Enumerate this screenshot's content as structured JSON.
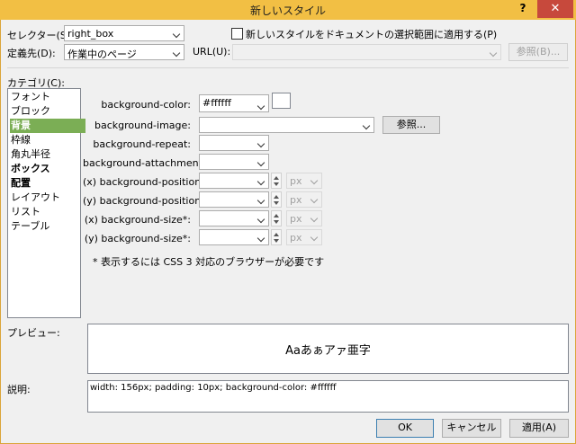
{
  "window": {
    "title": "新しいスタイル",
    "help": "?",
    "close": "✕"
  },
  "selector": {
    "label": "セレクター(S):",
    "value": "right_box"
  },
  "apply_selection": {
    "label": "新しいスタイルをドキュメントの選択範囲に適用する(P)"
  },
  "definition": {
    "label": "定義先(D):",
    "value": "作業中のページ"
  },
  "url": {
    "label": "URL(U):",
    "value": "",
    "browse": "参照(B)..."
  },
  "category": {
    "label": "カテゴリ(C):",
    "items": [
      "フォント",
      "ブロック",
      "背景",
      "枠線",
      "角丸半径",
      "ボックス",
      "配置",
      "レイアウト",
      "リスト",
      "テーブル"
    ]
  },
  "fields": {
    "bg_color": {
      "label": "background-color:",
      "value": "#ffffff"
    },
    "bg_image": {
      "label": "background-image:",
      "value": "",
      "browse": "参照..."
    },
    "bg_repeat": {
      "label": "background-repeat:",
      "value": ""
    },
    "bg_attachment": {
      "label": "background-attachment:",
      "value": ""
    },
    "bg_pos_x": {
      "label": "(x) background-position:",
      "value": "",
      "unit": "px"
    },
    "bg_pos_y": {
      "label": "(y) background-position:",
      "value": "",
      "unit": "px"
    },
    "bg_size_x": {
      "label": "(x) background-size*:",
      "value": "",
      "unit": "px"
    },
    "bg_size_y": {
      "label": "(y) background-size*:",
      "value": "",
      "unit": "px"
    }
  },
  "note": "* 表示するには CSS 3 対応のブラウザーが必要です",
  "preview": {
    "label": "プレビュー:",
    "text": "Aaあぁアァ亜字"
  },
  "description": {
    "label": "説明:",
    "text": "width: 156px; padding: 10px; background-color: #ffffff"
  },
  "buttons": {
    "ok": "OK",
    "cancel": "キャンセル",
    "apply": "適用(A)"
  },
  "colors": {
    "title_bar": "#f2bf44",
    "close": "#c7493c",
    "selected_category": "#7bae55"
  }
}
